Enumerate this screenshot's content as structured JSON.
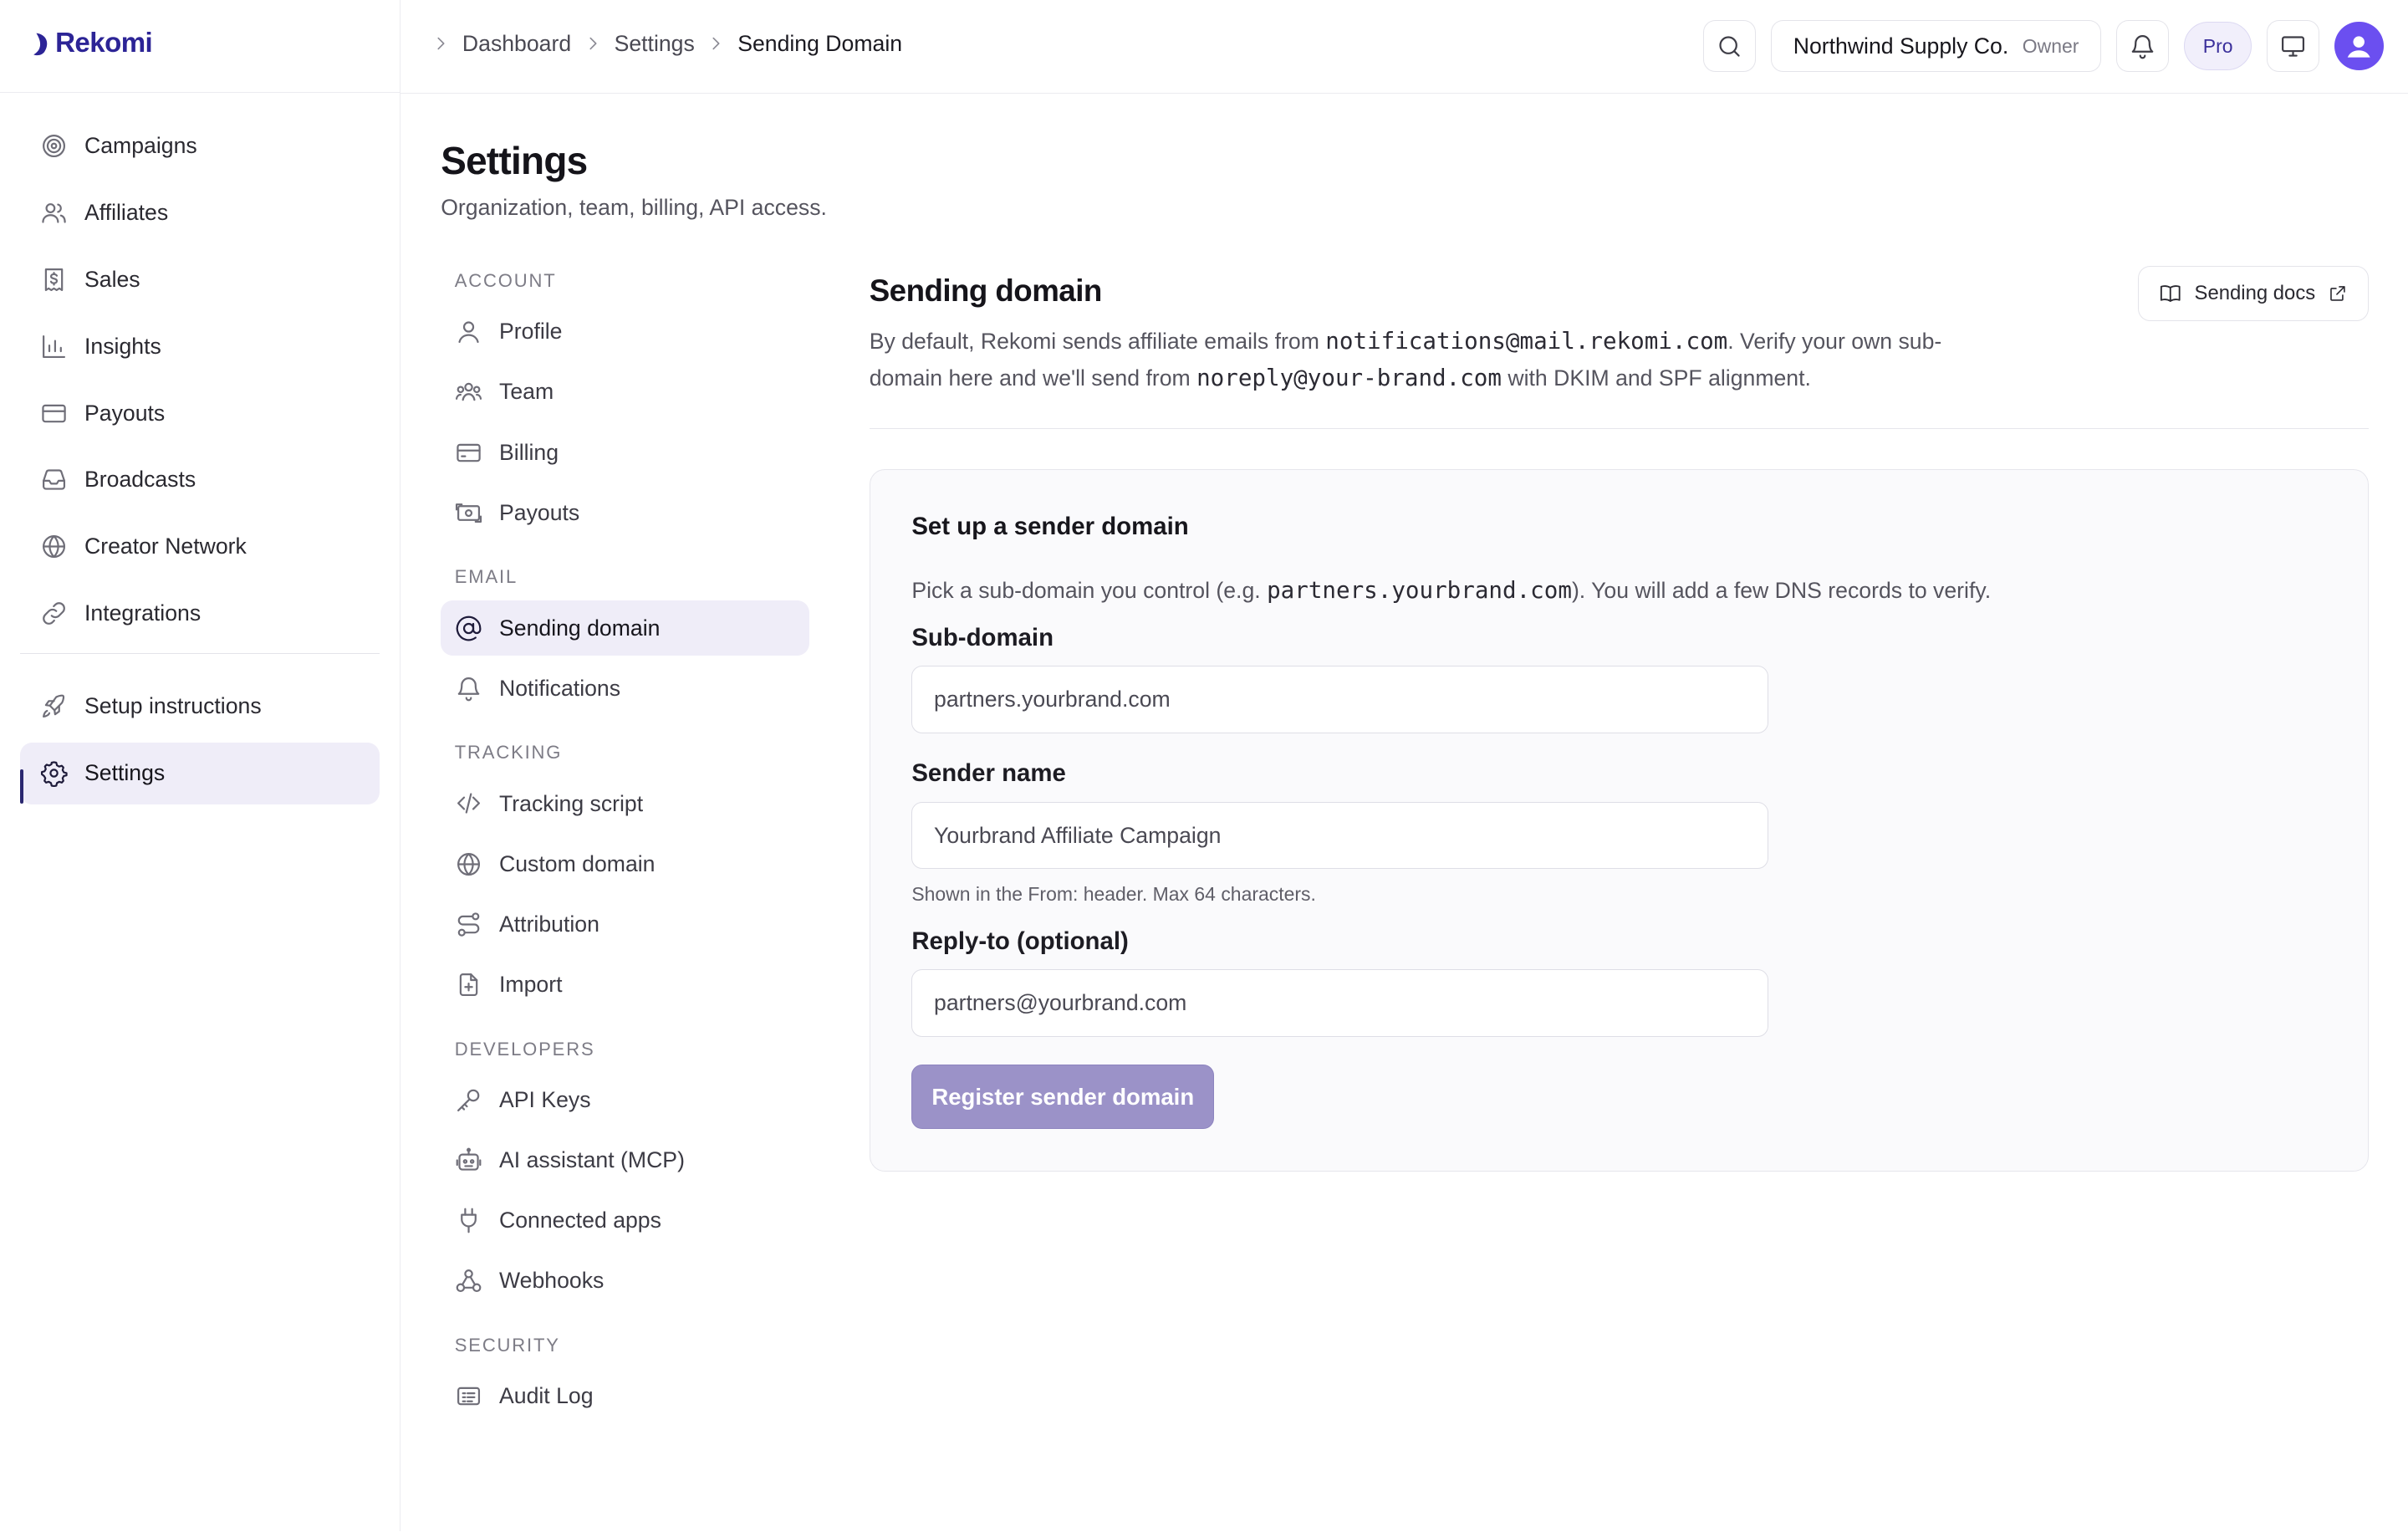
{
  "brand": {
    "name": "Rekomi"
  },
  "sidebar": {
    "items": [
      {
        "label": "Campaigns",
        "icon": "target-icon"
      },
      {
        "label": "Affiliates",
        "icon": "users-icon"
      },
      {
        "label": "Sales",
        "icon": "receipt-icon"
      },
      {
        "label": "Insights",
        "icon": "bar-chart-icon"
      },
      {
        "label": "Payouts",
        "icon": "card-icon"
      },
      {
        "label": "Broadcasts",
        "icon": "inbox-icon"
      },
      {
        "label": "Creator Network",
        "icon": "globe-icon"
      },
      {
        "label": "Integrations",
        "icon": "link-icon"
      }
    ],
    "bottom_items": [
      {
        "label": "Setup instructions",
        "icon": "rocket-icon"
      },
      {
        "label": "Settings",
        "icon": "gear-icon",
        "active": true
      }
    ]
  },
  "topbar": {
    "breadcrumb": [
      "Dashboard",
      "Settings",
      "Sending Domain"
    ],
    "org_name": "Northwind Supply Co.",
    "org_role": "Owner",
    "plan_badge": "Pro"
  },
  "page": {
    "title": "Settings",
    "subtitle": "Organization, team, billing, API access."
  },
  "subnav": {
    "account": {
      "heading": "Account",
      "items": [
        "Profile",
        "Team",
        "Billing",
        "Payouts"
      ]
    },
    "email": {
      "heading": "Email",
      "items": [
        "Sending domain",
        "Notifications"
      ]
    },
    "tracking": {
      "heading": "Tracking",
      "items": [
        "Tracking script",
        "Custom domain",
        "Attribution",
        "Import"
      ]
    },
    "developers": {
      "heading": "Developers",
      "items": [
        "API Keys",
        "AI assistant (MCP)",
        "Connected apps",
        "Webhooks"
      ]
    },
    "security": {
      "heading": "Security",
      "items": [
        "Audit Log"
      ]
    }
  },
  "main": {
    "title": "Sending domain",
    "docs_button": "Sending docs",
    "desc_1": "By default, Rekomi sends affiliate emails from ",
    "desc_default_address": "notifications@mail.rekomi.com",
    "desc_2": ". Verify your own sub-domain here and we'll send from ",
    "desc_custom_address": "noreply@your-brand.com",
    "desc_3": " with DKIM and SPF alignment."
  },
  "card": {
    "title": "Set up a sender domain",
    "desc_1": "Pick a sub-domain you control (e.g. ",
    "desc_example": "partners.yourbrand.com",
    "desc_2": "). You will add a few DNS records to verify.",
    "subdomain_label": "Sub-domain",
    "subdomain_placeholder": "partners.yourbrand.com",
    "sender_label": "Sender name",
    "sender_value": "Yourbrand Affiliate Campaign",
    "sender_hint": "Shown in the From: header. Max 64 characters.",
    "reply_label": "Reply-to (optional)",
    "reply_placeholder": "partners@yourbrand.com",
    "submit_label": "Register sender domain"
  }
}
